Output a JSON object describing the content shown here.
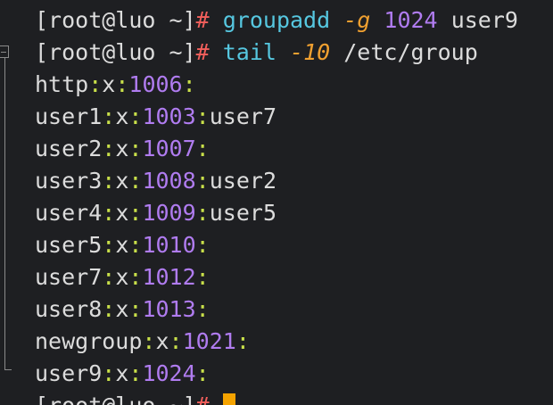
{
  "prompt": {
    "text": "[root@luo ~]",
    "hash": "#"
  },
  "commands": [
    {
      "cmd": "groupadd",
      "flag": "-g",
      "arg_num": "1024",
      "arg_text": "user9"
    },
    {
      "cmd": "tail",
      "flag": "-10",
      "arg_text": "/etc/group"
    }
  ],
  "group_entries": [
    {
      "name": "http",
      "pw": "x",
      "gid": "1006",
      "members": ""
    },
    {
      "name": "user1",
      "pw": "x",
      "gid": "1003",
      "members": "user7"
    },
    {
      "name": "user2",
      "pw": "x",
      "gid": "1007",
      "members": ""
    },
    {
      "name": "user3",
      "pw": "x",
      "gid": "1008",
      "members": "user2"
    },
    {
      "name": "user4",
      "pw": "x",
      "gid": "1009",
      "members": "user5"
    },
    {
      "name": "user5",
      "pw": "x",
      "gid": "1010",
      "members": ""
    },
    {
      "name": "user7",
      "pw": "x",
      "gid": "1012",
      "members": ""
    },
    {
      "name": "user8",
      "pw": "x",
      "gid": "1013",
      "members": ""
    },
    {
      "name": "newgroup",
      "pw": "x",
      "gid": "1021",
      "members": ""
    },
    {
      "name": "user9",
      "pw": "x",
      "gid": "1024",
      "members": ""
    }
  ],
  "separator": ":",
  "colors": {
    "background": "#1e1f22",
    "prompt_hash": "#f25f5c",
    "command": "#56c7e0",
    "flag": "#f0a030",
    "number": "#b07cf0",
    "separator": "#c9e04a",
    "cursor": "#f5a300"
  }
}
